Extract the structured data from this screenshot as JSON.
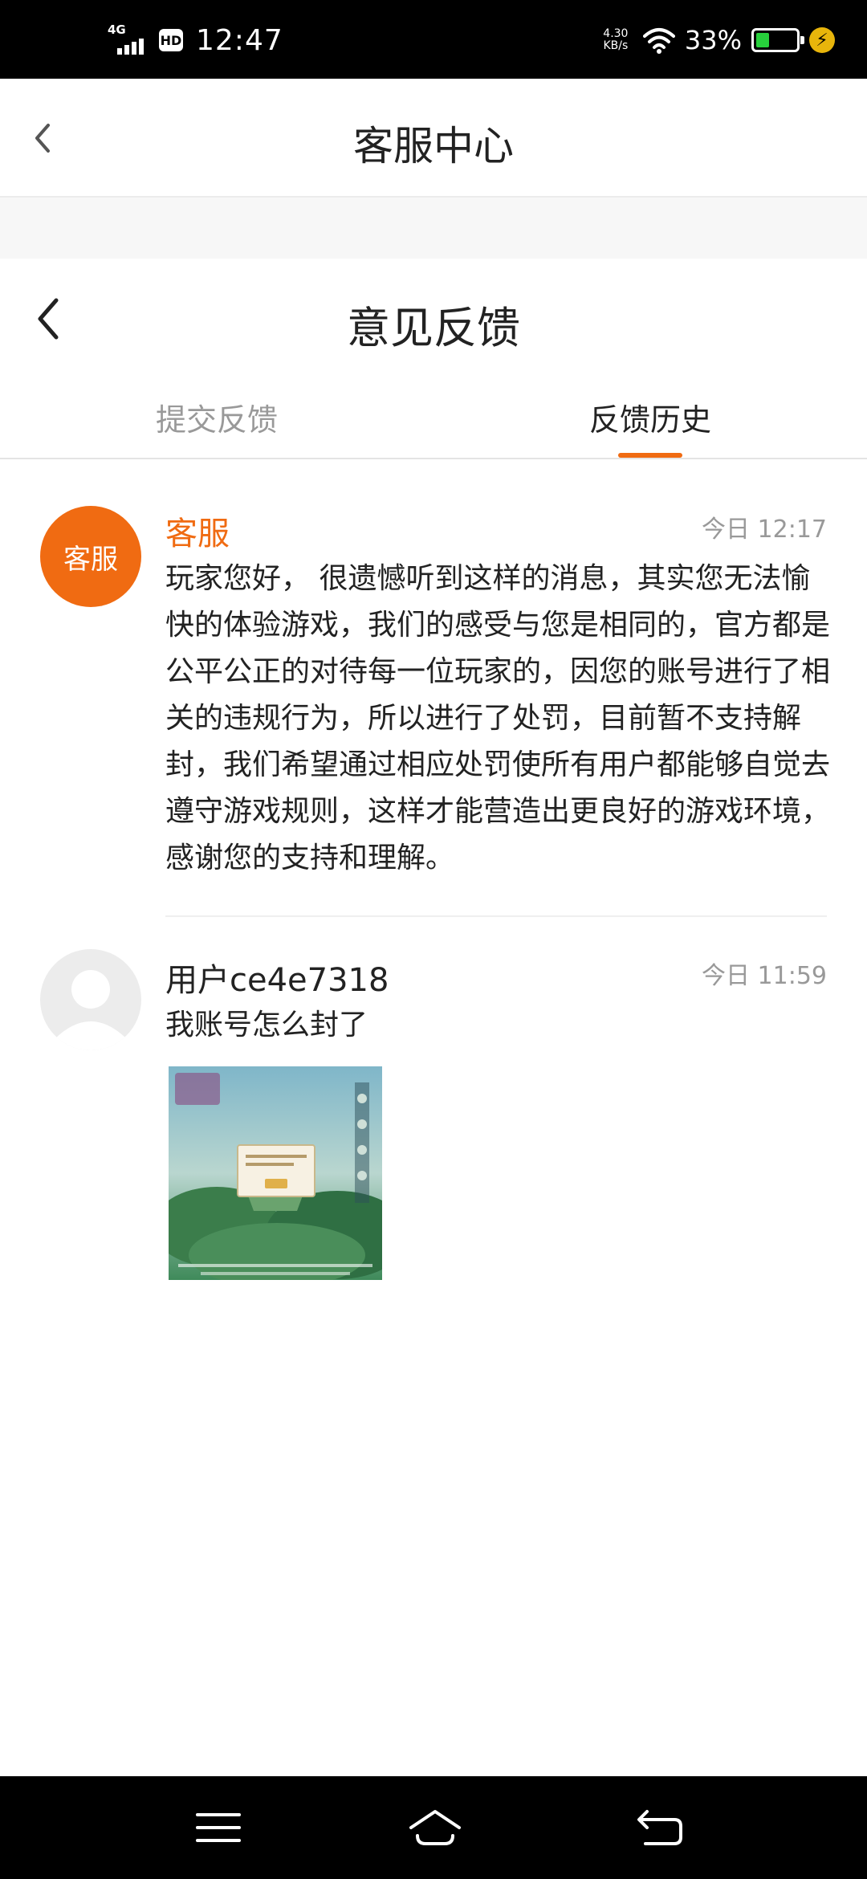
{
  "status_bar": {
    "network": "4G",
    "hd": "HD",
    "time": "12:47",
    "speed_value": "4.30",
    "speed_unit": "KB/s",
    "battery_percent": "33%",
    "battery_level": 0.33,
    "icons": [
      "signal-icon",
      "hd-icon",
      "wifi-icon",
      "battery-icon",
      "charging-icon"
    ]
  },
  "header": {
    "title": "客服中心",
    "back_icon": "chevron-left-icon"
  },
  "feedback_header": {
    "title": "意见反馈",
    "back_icon": "chevron-left-icon"
  },
  "tabs": [
    {
      "label": "提交反馈",
      "active": false
    },
    {
      "label": "反馈历史",
      "active": true
    }
  ],
  "messages": [
    {
      "avatar_text": "客服",
      "name": "客服",
      "time": "今日 12:17",
      "text": "玩家您好， 很遗憾听到这样的消息，其实您无法愉快的体验游戏，我们的感受与您是相同的，官方都是公平公正的对待每一位玩家的，因您的账号进行了相关的违规行为，所以进行了处罚，目前暂不支持解封，我们希望通过相应处罚使所有用户都能够自觉去遵守游戏规则，这样才能营造出更良好的游戏环境，感谢您的支持和理解。"
    },
    {
      "avatar_icon": "default-user-avatar-icon",
      "name": "用户ce4e7318",
      "time": "今日 11:59",
      "text": "我账号怎么封了",
      "attachment": "game-screenshot-thumbnail"
    }
  ],
  "nav_bar": {
    "icons": [
      "menu-icon",
      "home-icon",
      "back-icon"
    ]
  },
  "colors": {
    "accent": "#f06b12",
    "text": "#222222",
    "muted": "#999999",
    "battery": "#27d13c"
  }
}
